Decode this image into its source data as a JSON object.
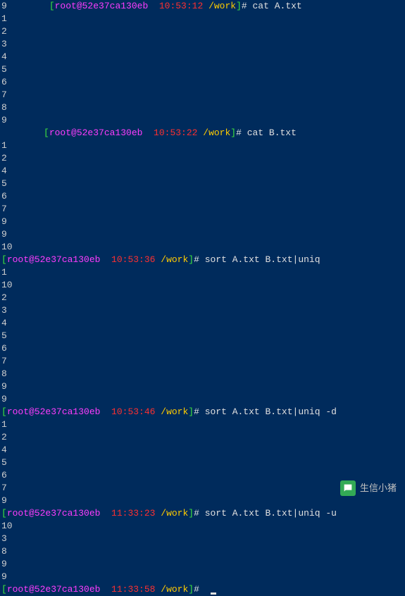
{
  "blocks": [
    {
      "prompt": {
        "userhost": "root@52e37ca130eb",
        "time": "10:53:12",
        "path": "/work",
        "cmd": "cat A.txt",
        "indent": true,
        "prefix": "9"
      },
      "output": [
        "1",
        "2",
        "3",
        "4",
        "5",
        "6",
        "7",
        "8",
        "9"
      ]
    },
    {
      "prompt": {
        "userhost": "root@52e37ca130eb",
        "time": "10:53:22",
        "path": "/work",
        "cmd": "cat B.txt",
        "indent": true,
        "prefix": ""
      },
      "output": [
        "1",
        "2",
        "4",
        "5",
        "6",
        "7",
        "9",
        "9",
        "10"
      ]
    },
    {
      "prompt": {
        "userhost": "root@52e37ca130eb",
        "time": "10:53:36",
        "path": "/work",
        "cmd": "sort A.txt B.txt|uniq",
        "indent": false,
        "prefix": ""
      },
      "output": [
        "1",
        "10",
        "2",
        "3",
        "4",
        "5",
        "6",
        "7",
        "8",
        "9",
        "9"
      ]
    },
    {
      "prompt": {
        "userhost": "root@52e37ca130eb",
        "time": "10:53:46",
        "path": "/work",
        "cmd": "sort A.txt B.txt|uniq -d",
        "indent": false,
        "prefix": ""
      },
      "output": [
        "1",
        "2",
        "4",
        "5",
        "6",
        "7",
        "9"
      ]
    },
    {
      "prompt": {
        "userhost": "root@52e37ca130eb",
        "time": "11:33:23",
        "path": "/work",
        "cmd": "sort A.txt B.txt|uniq -u",
        "indent": false,
        "prefix": ""
      },
      "output": [
        "10",
        "3",
        "8",
        "9",
        "9"
      ]
    },
    {
      "prompt": {
        "userhost": "root@52e37ca130eb",
        "time": "11:33:58",
        "path": "/work",
        "cmd": "",
        "indent": false,
        "prefix": "",
        "cursor": true
      },
      "output": []
    }
  ],
  "watermark": "生信小猪"
}
